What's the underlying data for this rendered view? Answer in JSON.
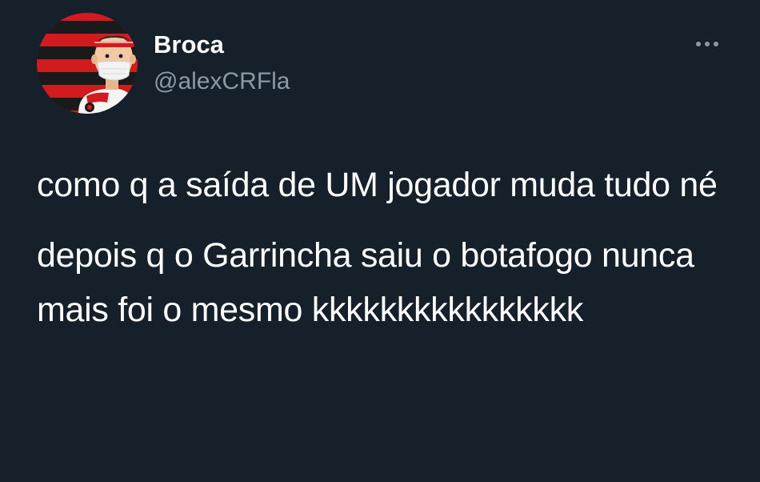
{
  "author": {
    "display_name": "Broca",
    "handle": "@alexCRFla",
    "avatar_icon": "avatar-cartoon-masked-fan",
    "avatar_colors": {
      "red": "#d11b1f",
      "black": "#1a1a1a",
      "skin": "#f1c9a4"
    }
  },
  "tweet": {
    "paragraph_1": "como q a saída de UM jogador muda tudo né",
    "paragraph_2": "depois q o Garrincha saiu o botafogo nunca mais foi o mesmo kkkkkkkkkkkkkkkk"
  },
  "menu": {
    "icon": "more-horizontal-icon"
  },
  "theme": {
    "background": "#15202b",
    "text_primary": "#ffffff",
    "text_secondary": "#8b98a5"
  }
}
